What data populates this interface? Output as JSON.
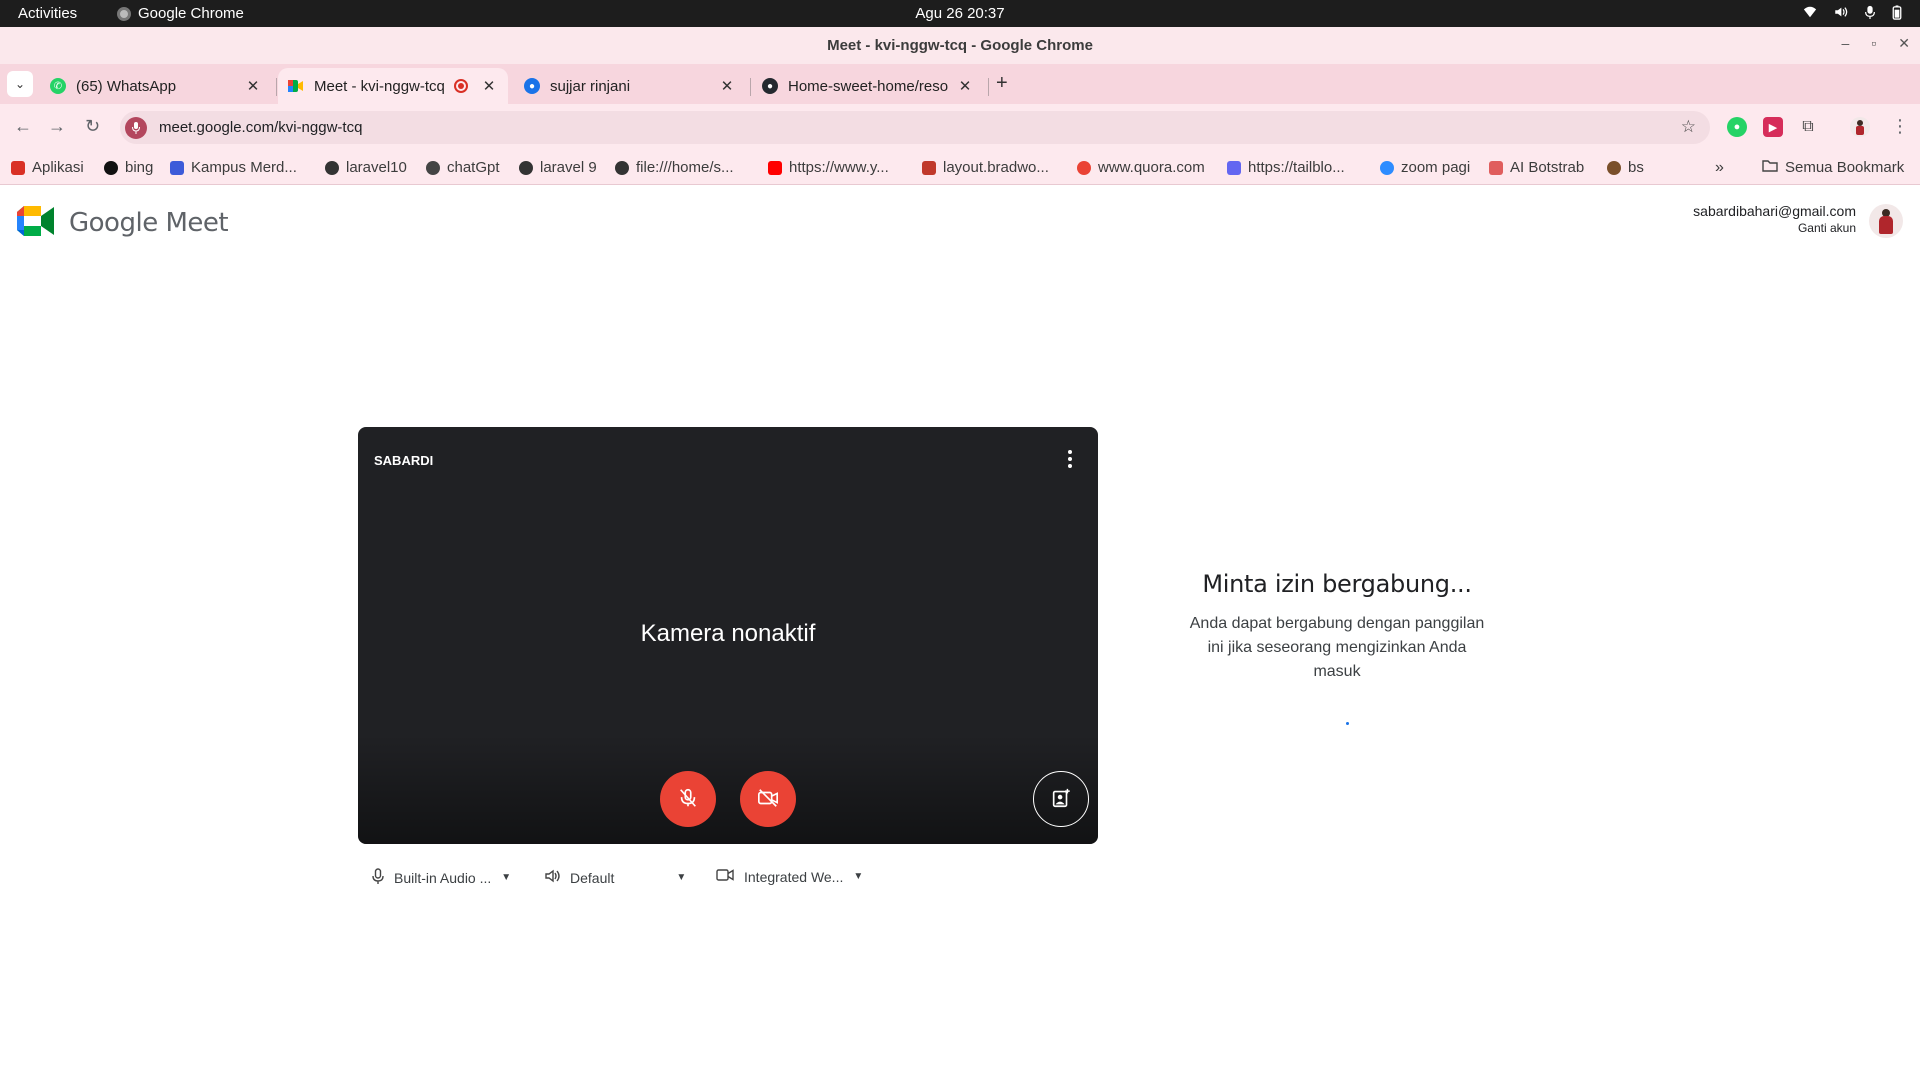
{
  "system_bar": {
    "activities": "Activities",
    "app_name": "Google Chrome",
    "clock": "Agu 26  20:37",
    "tray_icons": [
      "wifi-icon",
      "volume-icon",
      "mic-icon",
      "battery-icon"
    ]
  },
  "window": {
    "title": "Meet - kvi-nggw-tcq - Google Chrome",
    "controls": [
      "–",
      "▫",
      "✕"
    ]
  },
  "tabs": [
    {
      "title": "(65) WhatsApp",
      "favicon": "whatsapp-icon",
      "color": "#25d366",
      "active": false
    },
    {
      "title": "Meet - kvi-nggw-tcq",
      "favicon": "meet-icon",
      "color": "#00832d",
      "active": true,
      "recording": true
    },
    {
      "title": "sujjar rinjani",
      "favicon": "globe-icon",
      "color": "#1a73e8",
      "active": false
    },
    {
      "title": "Home-sweet-home/reso",
      "favicon": "github-icon",
      "color": "#24292f",
      "active": false
    }
  ],
  "new_tab": "+",
  "toolbar": {
    "url": "meet.google.com/kvi-nggw-tcq",
    "star": "☆"
  },
  "bookmarks": [
    {
      "label": "Aplikasi",
      "icon": "apps-grid-icon",
      "color": "#d93025"
    },
    {
      "label": "bing",
      "icon": "bing-icon",
      "color": "#111111"
    },
    {
      "label": "Kampus Merd...",
      "icon": "kampus-merdeka-icon",
      "color": "#3d5bd9"
    },
    {
      "label": "laravel10",
      "icon": "globe-icon",
      "color": "#333333"
    },
    {
      "label": "chatGpt",
      "icon": "openai-icon",
      "color": "#444444"
    },
    {
      "label": "laravel 9",
      "icon": "globe-icon",
      "color": "#333333"
    },
    {
      "label": "file:///home/s...",
      "icon": "globe-icon",
      "color": "#333333"
    },
    {
      "label": "https://www.y...",
      "icon": "youtube-icon",
      "color": "#ff0000"
    },
    {
      "label": "layout.bradwo...",
      "icon": "grid-icon",
      "color": "#c0392b"
    },
    {
      "label": "www.quora.com",
      "icon": "google-icon",
      "color": "#ea4335"
    },
    {
      "label": "https://tailblo...",
      "icon": "tailblocks-icon",
      "color": "#6366f1"
    },
    {
      "label": "zoom pagi",
      "icon": "zoom-icon",
      "color": "#2d8cff"
    },
    {
      "label": "AI Botstrab",
      "icon": "bootstrap-icon",
      "color": "#e05d5d"
    },
    {
      "label": "bs",
      "icon": "bs-icon",
      "color": "#7a4f2a"
    }
  ],
  "bookmarks_overflow": "»",
  "all_bookmarks": "Semua Bookmark",
  "meet": {
    "logo_text": "Google Meet",
    "account_email": "sabardibahari@gmail.com",
    "switch_account": "Ganti akun",
    "self_name": "SABARDI",
    "camera_status": "Kamera nonaktif",
    "mic_button_color": "#ea4335",
    "cam_button_color": "#ea4335",
    "devices": {
      "microphone": "Built-in Audio ...",
      "speaker": "Default",
      "camera": "Integrated We..."
    },
    "join_heading": "Minta izin bergabung...",
    "join_description": "Anda dapat bergabung dengan panggilan ini jika seseorang mengizinkan Anda masuk"
  }
}
